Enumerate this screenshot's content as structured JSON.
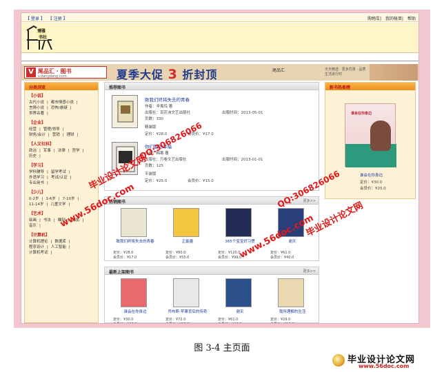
{
  "topbar": {
    "left_links": [
      "【 登录 】",
      "【 注册 】"
    ],
    "right_links": [
      "购物车",
      "我的帐单",
      "帮助"
    ]
  },
  "logo": {
    "line1": "博雅",
    "line2": "书社"
  },
  "banner": {
    "brand": "尾品汇 · 图书",
    "brand_url": "v.dangdang.com",
    "promo_prefix": "夏季大促",
    "promo_num": "3",
    "promo_suffix": "折封顶",
    "side_text": "尾品汇",
    "side_small": "天天精选 · 更多优惠 · 品质生活进行时"
  },
  "left": {
    "title": "分类浏览",
    "cats": [
      {
        "head": "【小说】",
        "lines": [
          [
            "古代小说",
            "都市情感小说"
          ],
          [
            "言情小说",
            "恐怖/悬疑"
          ],
          [
            "世界名著"
          ]
        ]
      },
      {
        "head": "【企业】",
        "lines": [
          [
            "经营",
            "管理/领导"
          ],
          [
            "财务/会计",
            "营销",
            "理财"
          ]
        ]
      },
      {
        "head": "【人文社科】",
        "lines": [
          [
            "政治",
            "军事",
            "法律",
            "哲学"
          ],
          [
            "历史"
          ]
        ]
      },
      {
        "head": "【学习】",
        "lines": [
          [
            "学科辅导",
            "留学考试"
          ],
          [
            "外语学习",
            "考试/认证"
          ],
          [
            "专业用书"
          ]
        ]
      },
      {
        "head": "【少儿】",
        "lines": [
          [
            "0-2岁",
            "3-6岁",
            "7-10岁"
          ],
          [
            "11-14岁",
            "儿童文学"
          ]
        ]
      },
      {
        "head": "【艺术】",
        "lines": [
          [
            "绘画",
            "书法",
            "雕刻",
            "摄影"
          ],
          [
            "音乐"
          ]
        ]
      },
      {
        "head": "【计算机】",
        "lines": [
          [
            "计算机理论",
            "数据库"
          ],
          [
            "程序设计",
            "人工智能"
          ],
          [
            "计算机考试"
          ]
        ]
      }
    ]
  },
  "recommend": {
    "title": "推荐图书",
    "items": [
      {
        "name": "致我们终将失去的青春",
        "author": "作者：辛夷坞 著",
        "press": "出版社：百花洲文艺出版社",
        "pubdate": "出版时间：2013-05-01",
        "pages": "页数：330",
        "bind": "精装版",
        "price": "定价：¥28.0",
        "member": "会员价：¥17.0"
      },
      {
        "name": "你们都的幸福",
        "author": "作者：韩寒 著",
        "press": "出版社：万卷文艺出版社",
        "pubdate": "出版时间：2013-01-01",
        "pages": "页数：125",
        "bind": "平装版",
        "price": "定价：¥25.0",
        "member": "会员价：¥15.0"
      }
    ]
  },
  "hot": {
    "title": "热销图书",
    "more": "更多>>",
    "items": [
      {
        "name": "致我们终将失去的青春",
        "price": "定价：¥28.0",
        "member": "会员价：¥17.0"
      },
      {
        "name": "正能量",
        "price": "定价：¥80.0",
        "member": "会员价：¥55.0"
      },
      {
        "name": "365个宝宝好习惯",
        "price": "定价：¥120.0",
        "member": "会员价：¥99.0"
      },
      {
        "name": "谢天",
        "price": "定价：¥61.0",
        "member": "会员价：¥40.0"
      }
    ]
  },
  "latest": {
    "title": "最新上架图书",
    "more": "更多>>",
    "items": [
      {
        "name": "谁会在你身边",
        "price": "定价：¥30.0",
        "member": "会员价：¥20.0"
      },
      {
        "name": "乔布斯·苹果背后的传奇",
        "price": "定价：¥72.0",
        "member": "会员价：¥55.0"
      },
      {
        "name": "谢天",
        "price": "定价：¥61.0",
        "member": "会员价：¥40.0"
      },
      {
        "name": "我所理解的生活",
        "price": "定价：¥29.0",
        "member": "会员价：¥19.0"
      }
    ]
  },
  "right": {
    "title": "新书热卖榜",
    "cover_title": "谁会在你身边",
    "name": "谁会在你身边",
    "price": "定价：¥30.0",
    "member": "会员价：¥20.0"
  },
  "watermarks": [
    "毕业设计论文网",
    "www.56doc.com",
    "QQ:306826066",
    "毕业设计论文网",
    "www.56doc.com",
    "QQ:306826066"
  ],
  "caption": "图 3-4 主页面",
  "footlogo": {
    "t1": "毕业设计论文网",
    "t2": "www.56doc.com"
  },
  "colors": {
    "frame": "#f2c7d0",
    "accent": "#c2231e",
    "link": "#1a3a9c"
  }
}
